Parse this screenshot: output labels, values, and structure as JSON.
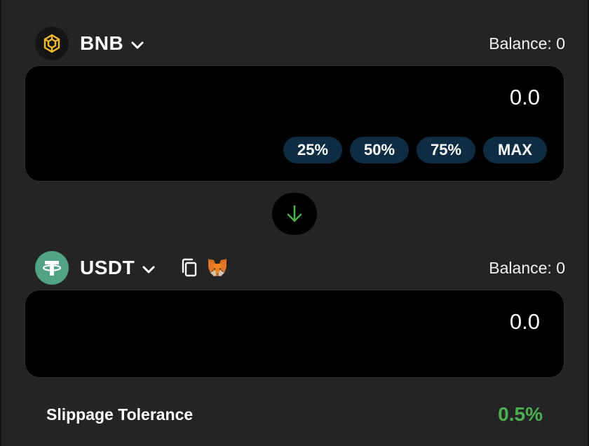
{
  "colors": {
    "background": "#242424",
    "panel": "#000000",
    "pill": "#0f2d42",
    "accent_green": "#4caf50",
    "bnb_yellow": "#f3ba2f",
    "usdt_green": "#50a383"
  },
  "from": {
    "symbol": "BNB",
    "icon": "bnb-coin-icon",
    "balance": "Balance: 0",
    "amount": "0.0",
    "percent_buttons": [
      "25%",
      "50%",
      "75%",
      "MAX"
    ]
  },
  "swap_direction_icon": "arrow-down-icon",
  "to": {
    "symbol": "USDT",
    "icon": "usdt-coin-icon",
    "copy_icon": "copy-icon",
    "wallet_icon": "metamask-fox-icon",
    "balance": "Balance: 0",
    "amount": "0.0"
  },
  "slippage": {
    "label": "Slippage Tolerance",
    "value": "0.5%"
  }
}
